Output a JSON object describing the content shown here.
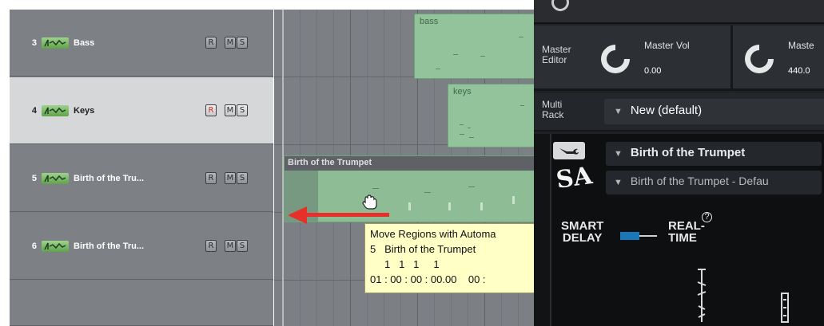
{
  "tracks": [
    {
      "number": "3",
      "name": "Bass",
      "record": "R",
      "mute": "M",
      "solo": "S",
      "armed": false,
      "selected": false
    },
    {
      "number": "4",
      "name": "Keys",
      "record": "R",
      "mute": "M",
      "solo": "S",
      "armed": true,
      "selected": true
    },
    {
      "number": "5",
      "name": "Birth of the Tru...",
      "record": "R",
      "mute": "M",
      "solo": "S",
      "armed": false,
      "selected": false
    },
    {
      "number": "6",
      "name": "Birth of the Tru...",
      "record": "R",
      "mute": "M",
      "solo": "S",
      "armed": false,
      "selected": false
    }
  ],
  "regions": {
    "bass": "bass",
    "keys": "keys",
    "trumpet_header": "Birth of the Trumpet"
  },
  "tooltip": {
    "line1": "Move Regions with Automa",
    "line2": "5   Birth of the Trumpet",
    "line3": "1   1   1     1",
    "line4": "01 : 00 : 00 : 00.00    00 :"
  },
  "panel": {
    "master_editor": [
      "Master",
      "Editor"
    ],
    "master_vol_label": "Master Vol",
    "master_vol_value": "0.00",
    "master_tune_label": "Maste",
    "master_tune_value": "440.0",
    "multi_rack": [
      "Multi",
      "Rack"
    ],
    "rack_preset": "New (default)",
    "instrument_name": "Birth of the Trumpet",
    "instrument_snapshot": "Birth of the Trumpet - Defau",
    "wrench_icon": "wrench-icon",
    "logo_text": "SA",
    "smart_delay": [
      "SMART",
      "DELAY"
    ],
    "real_time": [
      "REAL-",
      "TIME"
    ],
    "help_icon": "?"
  },
  "colors": {
    "region_green": "#93c39a",
    "record_armed": "#d52a24",
    "arrow_red": "#e8302b",
    "toggle_blue": "#1a78b8",
    "tooltip_bg": "#ffffc6"
  }
}
